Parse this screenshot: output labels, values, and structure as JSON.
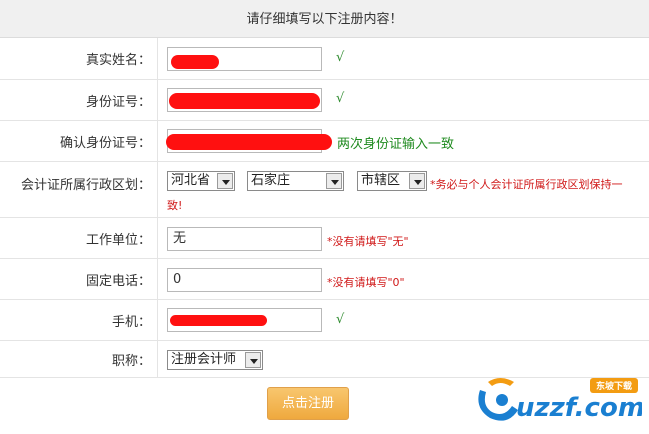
{
  "header": {
    "title": "请仔细填写以下注册内容！"
  },
  "form": {
    "real_name": {
      "label": "真实姓名：",
      "value": "",
      "check": "√"
    },
    "id_number": {
      "label": "身份证号：",
      "value": "",
      "check": "√"
    },
    "confirm_id": {
      "label": "确认身份证号：",
      "value": "",
      "hint": "两次身份证输入一致"
    },
    "region": {
      "label": "会计证所属行政区划：",
      "province": "河北省",
      "city": "石家庄",
      "district": "市辖区",
      "hint_line1": "*务必与个人会计证所属行政区划保持一",
      "hint_line2": "致!"
    },
    "work_unit": {
      "label": "工作单位：",
      "value": "无",
      "hint": "*没有请填写\"无\""
    },
    "phone": {
      "label": "固定电话：",
      "value": "0",
      "hint": "*没有请填写\"0\""
    },
    "mobile": {
      "label": "手机：",
      "value": "",
      "check": "√"
    },
    "title": {
      "label": "职称：",
      "value": "注册会计师"
    }
  },
  "submit_label": "点击注册",
  "watermark": {
    "text": "uzzf.com",
    "badge": "东坡下载"
  },
  "colors": {
    "redaction": "#ff1010",
    "success": "#1e8a1e",
    "warning": "#d01818",
    "button": "#f4b858"
  }
}
